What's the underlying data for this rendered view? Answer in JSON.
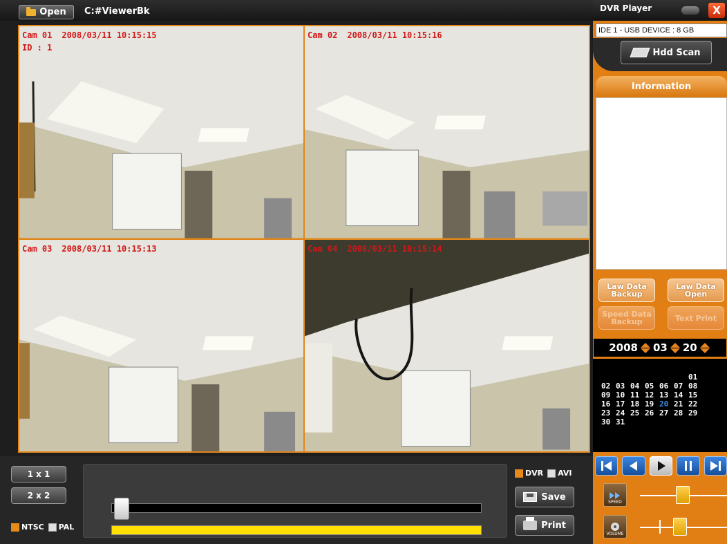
{
  "toolbar": {
    "open_label": "Open",
    "path": "C:#ViewerBk"
  },
  "cameras": [
    {
      "name": "Cam 01",
      "time": "2008/03/11 10:15:15",
      "id": "ID : 1"
    },
    {
      "name": "Cam 02",
      "time": "2008/03/11 10:15:16"
    },
    {
      "name": "Cam 03",
      "time": "2008/03/11 10:15:13"
    },
    {
      "name": "Cam 04",
      "time": "2008/03/11 10:15:14"
    }
  ],
  "layout_buttons": {
    "one": "1 x 1",
    "four": "2 x 2"
  },
  "video_std": {
    "ntsc": "NTSC",
    "pal": "PAL",
    "ntsc_checked": true,
    "pal_checked": false
  },
  "format": {
    "dvr": "DVR",
    "avi": "AVI",
    "dvr_checked": true,
    "avi_checked": false
  },
  "actions": {
    "save": "Save",
    "print": "Print"
  },
  "panel": {
    "title": "DVR Player",
    "close": "X",
    "device": "IDE 1 - USB DEVICE : 8 GB",
    "scan": "Hdd Scan",
    "info_title": "Information",
    "buttons": [
      {
        "line1": "Law Data",
        "line2": "Backup",
        "active": true
      },
      {
        "line1": "Law Data",
        "line2": "Open",
        "active": true
      },
      {
        "line1": "Speed Data",
        "line2": "Backup",
        "active": false
      },
      {
        "line1": "Text Print",
        "line2": "",
        "active": false
      }
    ],
    "date": {
      "year": "2008",
      "month": "03",
      "day": "20"
    },
    "calendar": [
      [
        "",
        "",
        "",
        "",
        "",
        "",
        "01"
      ],
      [
        "02",
        "03",
        "04",
        "05",
        "06",
        "07",
        "08"
      ],
      [
        "09",
        "10",
        "11",
        "12",
        "13",
        "14",
        "15"
      ],
      [
        "16",
        "17",
        "18",
        "19",
        "20",
        "21",
        "22"
      ],
      [
        "23",
        "24",
        "25",
        "26",
        "27",
        "28",
        "29"
      ],
      [
        "30",
        "31",
        "",
        "",
        "",
        "",
        ""
      ]
    ],
    "selected_day": "20",
    "speed_label": "SPEED",
    "volume_label": "VOLUME"
  },
  "colors": {
    "accent": "#e27f14",
    "overlay_text": "#d21717",
    "timeline_fill": "#ffe000"
  }
}
